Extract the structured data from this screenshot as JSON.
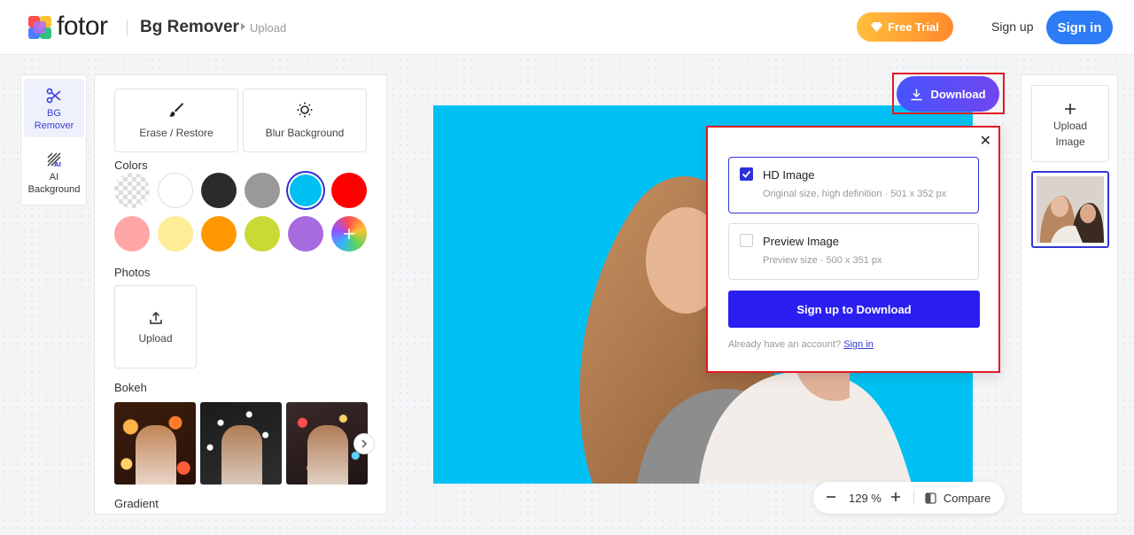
{
  "header": {
    "brand": "fotor",
    "app_title": "Bg Remover",
    "breadcrumb": "Upload",
    "free_trial": "Free Trial",
    "sign_up": "Sign up",
    "sign_in": "Sign in"
  },
  "rail": {
    "items": [
      {
        "label_1": "BG",
        "label_2": "Remover"
      },
      {
        "label_1": "AI",
        "label_2": "Background"
      }
    ]
  },
  "left_panel": {
    "tools": [
      "Erase / Restore",
      "Blur Background"
    ],
    "colors_label": "Colors",
    "swatches": [
      "transparent",
      "#ffffff",
      "#2b2b2b",
      "#999999",
      "#00c0f3",
      "#ff0000",
      "#ffa7a7",
      "#ffec96",
      "#ff9800",
      "#c9da36",
      "#a86adf",
      "custom"
    ],
    "photos_label": "Photos",
    "upload_label": "Upload",
    "bokeh_label": "Bokeh",
    "gradient_label": "Gradient"
  },
  "canvas": {
    "download_label": "Download",
    "zoom": "129 %",
    "compare": "Compare"
  },
  "download_popup": {
    "hd_title": "HD Image",
    "hd_desc": "Original size, high definition · 501 x 352 px",
    "hd_selected": true,
    "preview_title": "Preview Image",
    "preview_desc": "Preview size · 500 x 351 px",
    "preview_selected": false,
    "cta": "Sign up to Download",
    "account_text": "Already have an account?",
    "account_link": "Sign in"
  },
  "right_panel": {
    "upload_label_1": "Upload",
    "upload_label_2": "Image"
  },
  "colors": {
    "accent": "#2d32d8",
    "brand_blue": "#2d7cf6",
    "canvas_bg": "#00c0f3",
    "highlight": "#e01b24"
  }
}
